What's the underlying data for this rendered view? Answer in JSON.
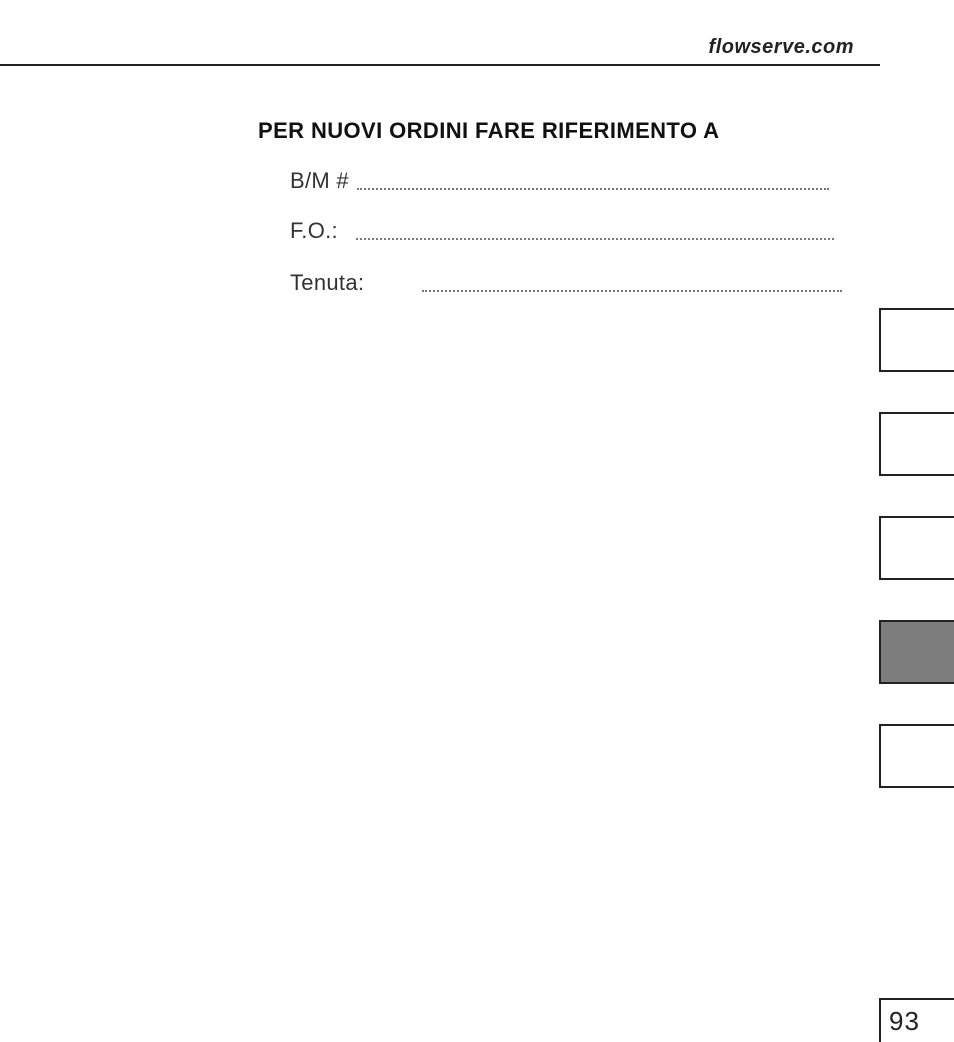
{
  "header": {
    "url_text": "flowserve.com"
  },
  "title": "PER NUOVI ORDINI FARE RIFERIMENTO A",
  "fields": {
    "bm_label": "B/M #",
    "fo_label": "F.O.:",
    "tenuta_label": "Tenuta:",
    "bm_value": "",
    "fo_value": "",
    "tenuta_value": ""
  },
  "side_tabs": {
    "active_index": 3
  },
  "page_number": "93"
}
